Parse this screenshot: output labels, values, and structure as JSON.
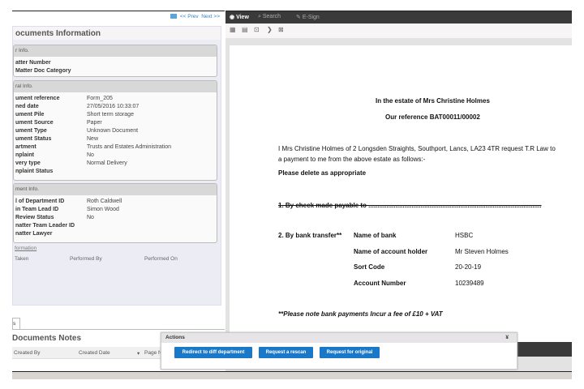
{
  "nav": {
    "prev": "<< Prev",
    "next": "Next >>"
  },
  "info": {
    "title": "ocuments Information",
    "matter": {
      "header": "r Info.",
      "rows": [
        {
          "label": "atter Number",
          "value": ""
        },
        {
          "label": "Matter Doc Category",
          "value": ""
        }
      ]
    },
    "general": {
      "header": "ral Info.",
      "rows": [
        {
          "label": "ument reference",
          "value": "Form_205"
        },
        {
          "label": "ned date",
          "value": "27/05/2016 10:33:07"
        },
        {
          "label": "ument Pile",
          "value": "Short term storage"
        },
        {
          "label": "ument Source",
          "value": "Paper"
        },
        {
          "label": "ument Type",
          "value": "Unknown Document"
        },
        {
          "label": "ument Status",
          "value": "New"
        },
        {
          "label": "artment",
          "value": "Trusts and Estates Administration"
        },
        {
          "label": "nplaint",
          "value": "No"
        },
        {
          "label": "very type",
          "value": "Normal Delivery"
        },
        {
          "label": "nplaint Status",
          "value": ""
        }
      ]
    },
    "assign": {
      "header": "ment Info.",
      "rows": [
        {
          "label": "l of Department ID",
          "value": "Roth Caldwell"
        },
        {
          "label": "in Team Lead ID",
          "value": "Simon Wood"
        },
        {
          "label": "Review Status",
          "value": "No"
        },
        {
          "label": "natter Team Leader ID",
          "value": ""
        },
        {
          "label": "natter Lawyer",
          "value": ""
        }
      ]
    },
    "history": {
      "link": "formation",
      "cols": [
        "Taken",
        "Performed By",
        "Performed On"
      ]
    }
  },
  "notes": {
    "tab": "s",
    "title": "Documents Notes",
    "cols": [
      "Created By",
      "Created Date",
      "Page N"
    ]
  },
  "viewer": {
    "tabs": [
      "View",
      "Search",
      "E-Sign"
    ]
  },
  "document": {
    "title": "In the estate of Mrs Christine Holmes",
    "reference": "Our reference BAT00011/00002",
    "para1": "I Mrs Christine Holmes of 2 Longsden Straights, Southport, Lancs, LA23 4TR request T.R Law to",
    "para2": "a payment to me from the above estate as follows:-",
    "delete": "Please delete as appropriate",
    "option1": "1. By check made payable to ................................................................................................",
    "option2": "2. By bank transfer**",
    "fields": [
      {
        "label": "Name of bank",
        "value": "HSBC"
      },
      {
        "label": "Name of account holder",
        "value": "Mr Steven Holmes"
      },
      {
        "label": "Sort Code",
        "value": "20-20-19"
      },
      {
        "label": "Account Number",
        "value": "10239489"
      }
    ],
    "note": "**Please note bank payments Incur a fee of £10 + VAT"
  },
  "actions": {
    "title": "Actions",
    "buttons": [
      "Redirect to diff department",
      "Request a rescan",
      "Request for original"
    ]
  },
  "colors": {
    "accent": "#1a78c9",
    "dark": "#3a3a3a"
  }
}
